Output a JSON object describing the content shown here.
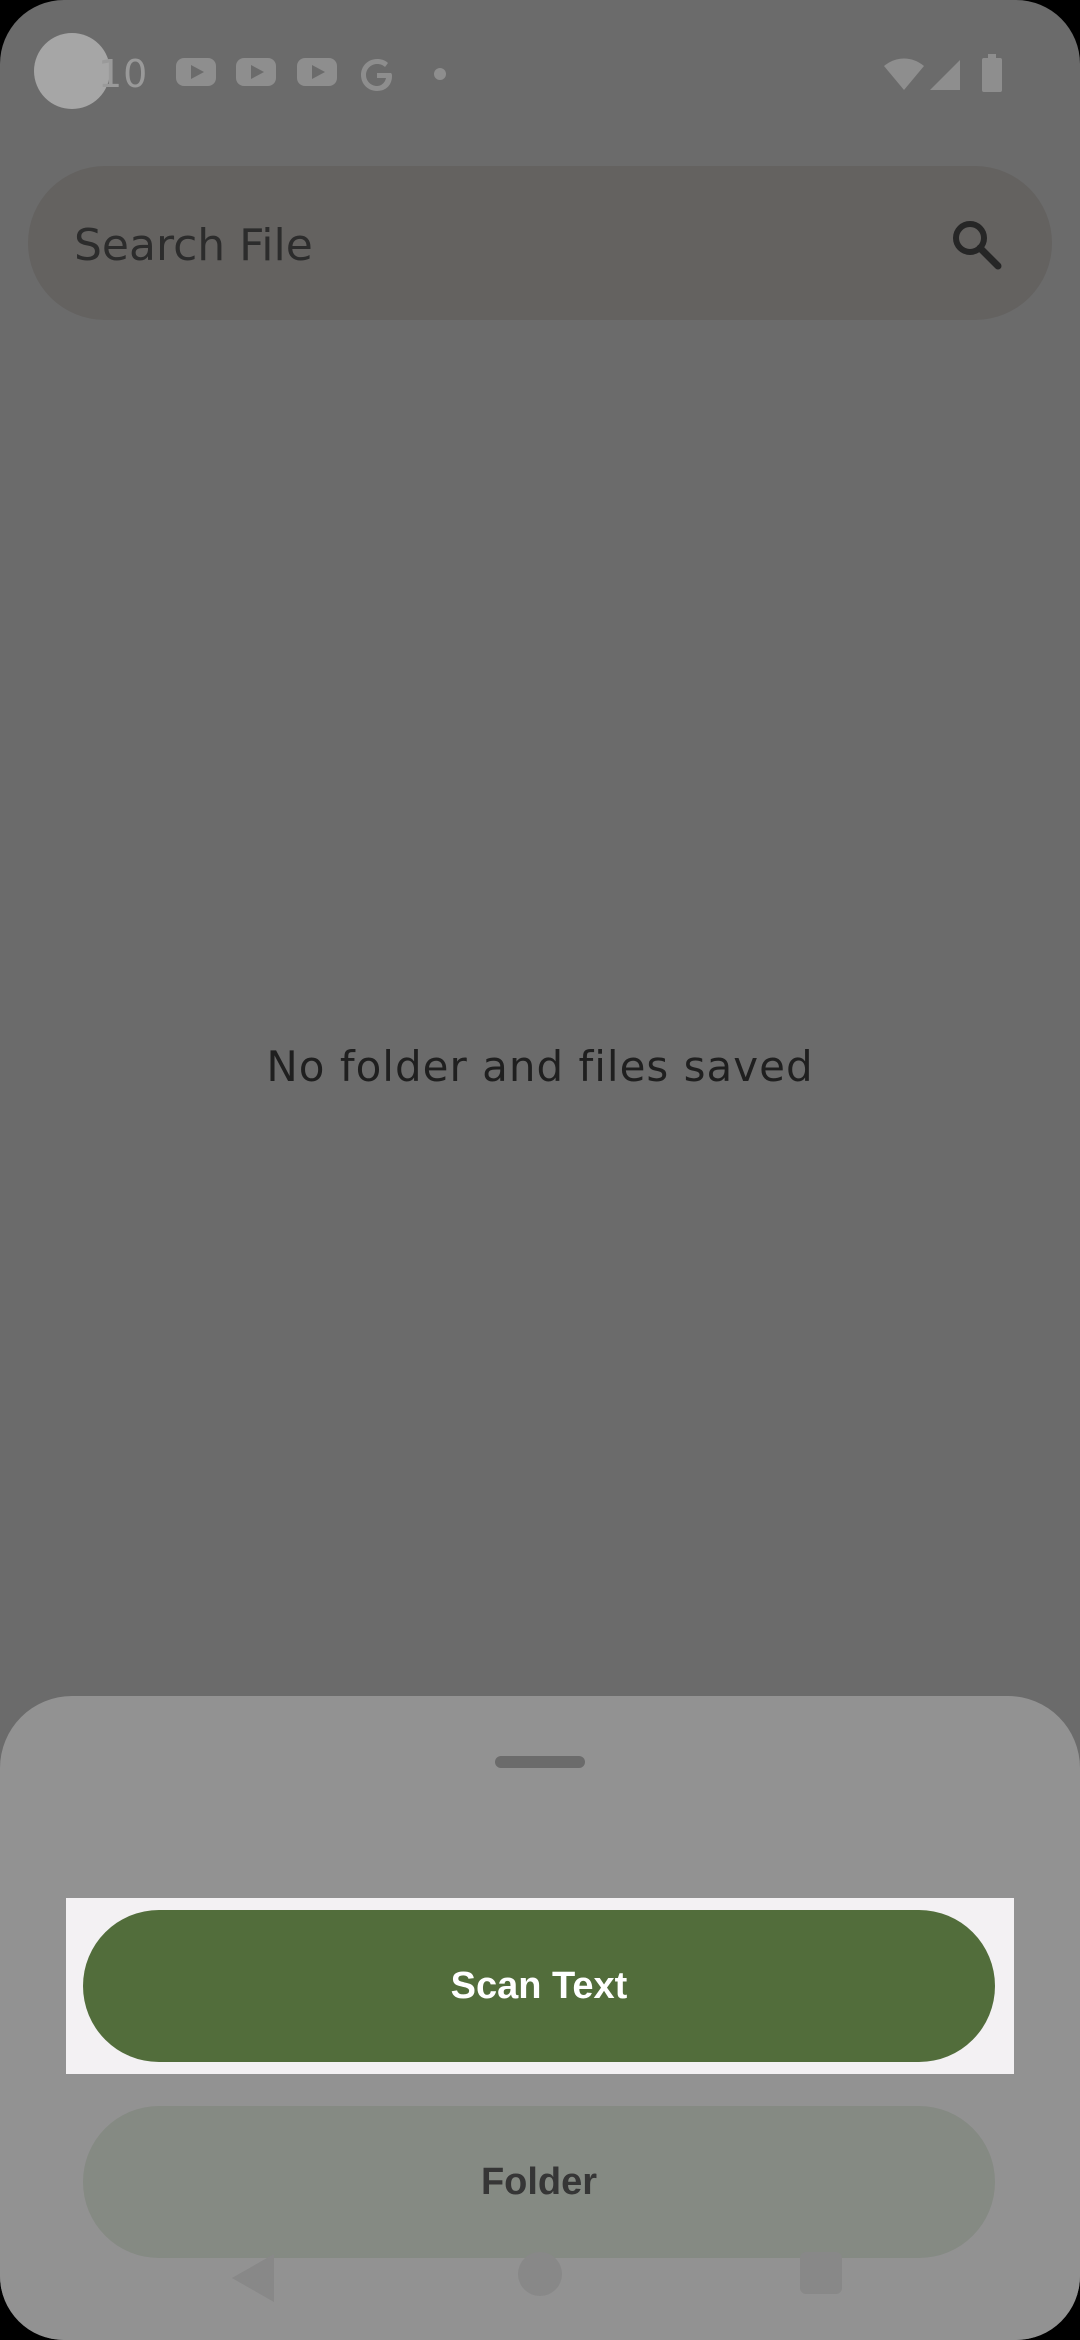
{
  "status_bar": {
    "time": "10",
    "icons": [
      "youtube-icon",
      "youtube-icon",
      "youtube-icon",
      "google-icon",
      "dot-icon",
      "wifi-icon",
      "signal-icon",
      "battery-icon"
    ]
  },
  "search": {
    "placeholder": "Search File",
    "icon": "search-icon"
  },
  "empty_state": {
    "message": "No folder and files saved"
  },
  "bottom_sheet": {
    "scan_label": "Scan Text",
    "folder_label": "Folder"
  },
  "navigation": {
    "icons": [
      "back-icon",
      "home-icon",
      "recents-icon"
    ]
  },
  "colors": {
    "scrim": "#6b6b6b",
    "primary": "#526d3b",
    "sheet": "#929292",
    "secondary_button": "#858a83"
  }
}
